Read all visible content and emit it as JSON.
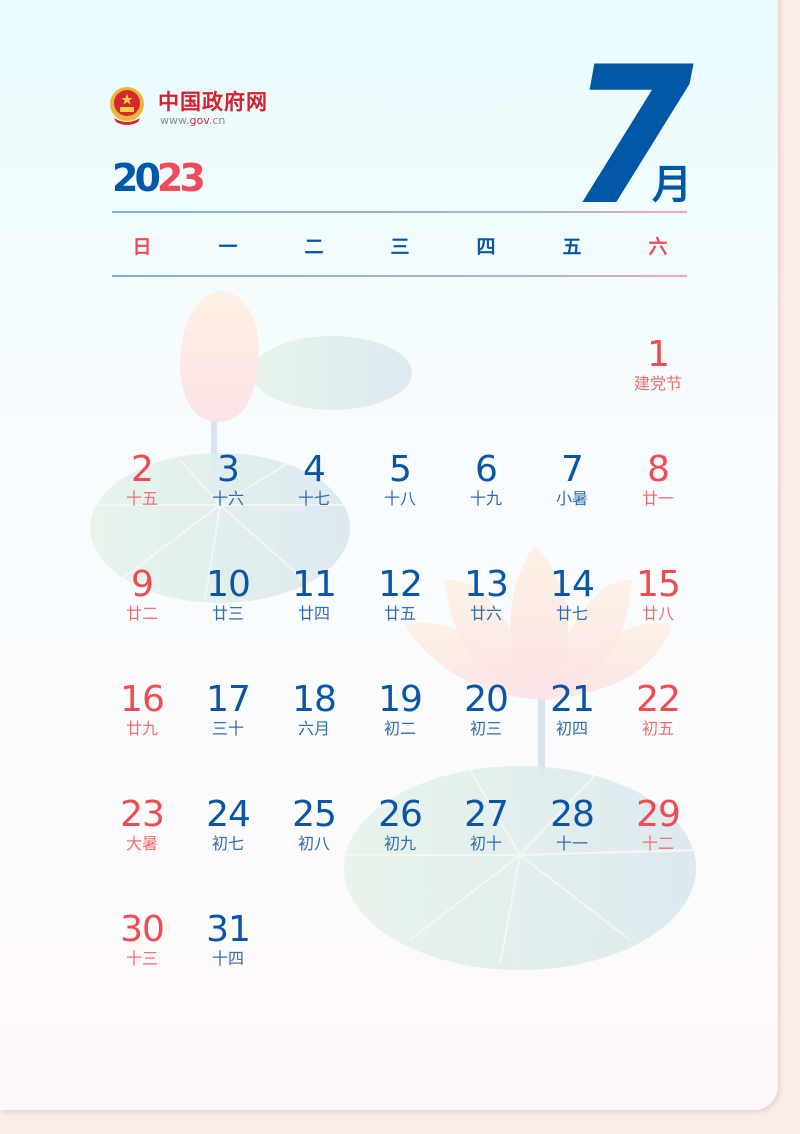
{
  "header": {
    "site_name": "中国政府网",
    "site_url_prefix": "www.",
    "site_url_mid": "gov",
    "site_url_suffix": ".cn",
    "year_part1": "20",
    "year_part2": "23",
    "month_number": "7",
    "month_unit": "月"
  },
  "weekdays": [
    "日",
    "一",
    "二",
    "三",
    "四",
    "五",
    "六"
  ],
  "colors": {
    "blue": "#0057a6",
    "red": "#f04b50"
  },
  "first_weekday_index": 6,
  "days": [
    {
      "day": "1",
      "lunar": "建党节"
    },
    {
      "day": "2",
      "lunar": "十五"
    },
    {
      "day": "3",
      "lunar": "十六"
    },
    {
      "day": "4",
      "lunar": "十七"
    },
    {
      "day": "5",
      "lunar": "十八"
    },
    {
      "day": "6",
      "lunar": "十九"
    },
    {
      "day": "7",
      "lunar": "小暑"
    },
    {
      "day": "8",
      "lunar": "廿一"
    },
    {
      "day": "9",
      "lunar": "廿二"
    },
    {
      "day": "10",
      "lunar": "廿三"
    },
    {
      "day": "11",
      "lunar": "廿四"
    },
    {
      "day": "12",
      "lunar": "廿五"
    },
    {
      "day": "13",
      "lunar": "廿六"
    },
    {
      "day": "14",
      "lunar": "廿七"
    },
    {
      "day": "15",
      "lunar": "廿八"
    },
    {
      "day": "16",
      "lunar": "廿九"
    },
    {
      "day": "17",
      "lunar": "三十"
    },
    {
      "day": "18",
      "lunar": "六月"
    },
    {
      "day": "19",
      "lunar": "初二"
    },
    {
      "day": "20",
      "lunar": "初三"
    },
    {
      "day": "21",
      "lunar": "初四"
    },
    {
      "day": "22",
      "lunar": "初五"
    },
    {
      "day": "23",
      "lunar": "大暑"
    },
    {
      "day": "24",
      "lunar": "初七"
    },
    {
      "day": "25",
      "lunar": "初八"
    },
    {
      "day": "26",
      "lunar": "初九"
    },
    {
      "day": "27",
      "lunar": "初十"
    },
    {
      "day": "28",
      "lunar": "十一"
    },
    {
      "day": "29",
      "lunar": "十二"
    },
    {
      "day": "30",
      "lunar": "十三"
    },
    {
      "day": "31",
      "lunar": "十四"
    }
  ]
}
